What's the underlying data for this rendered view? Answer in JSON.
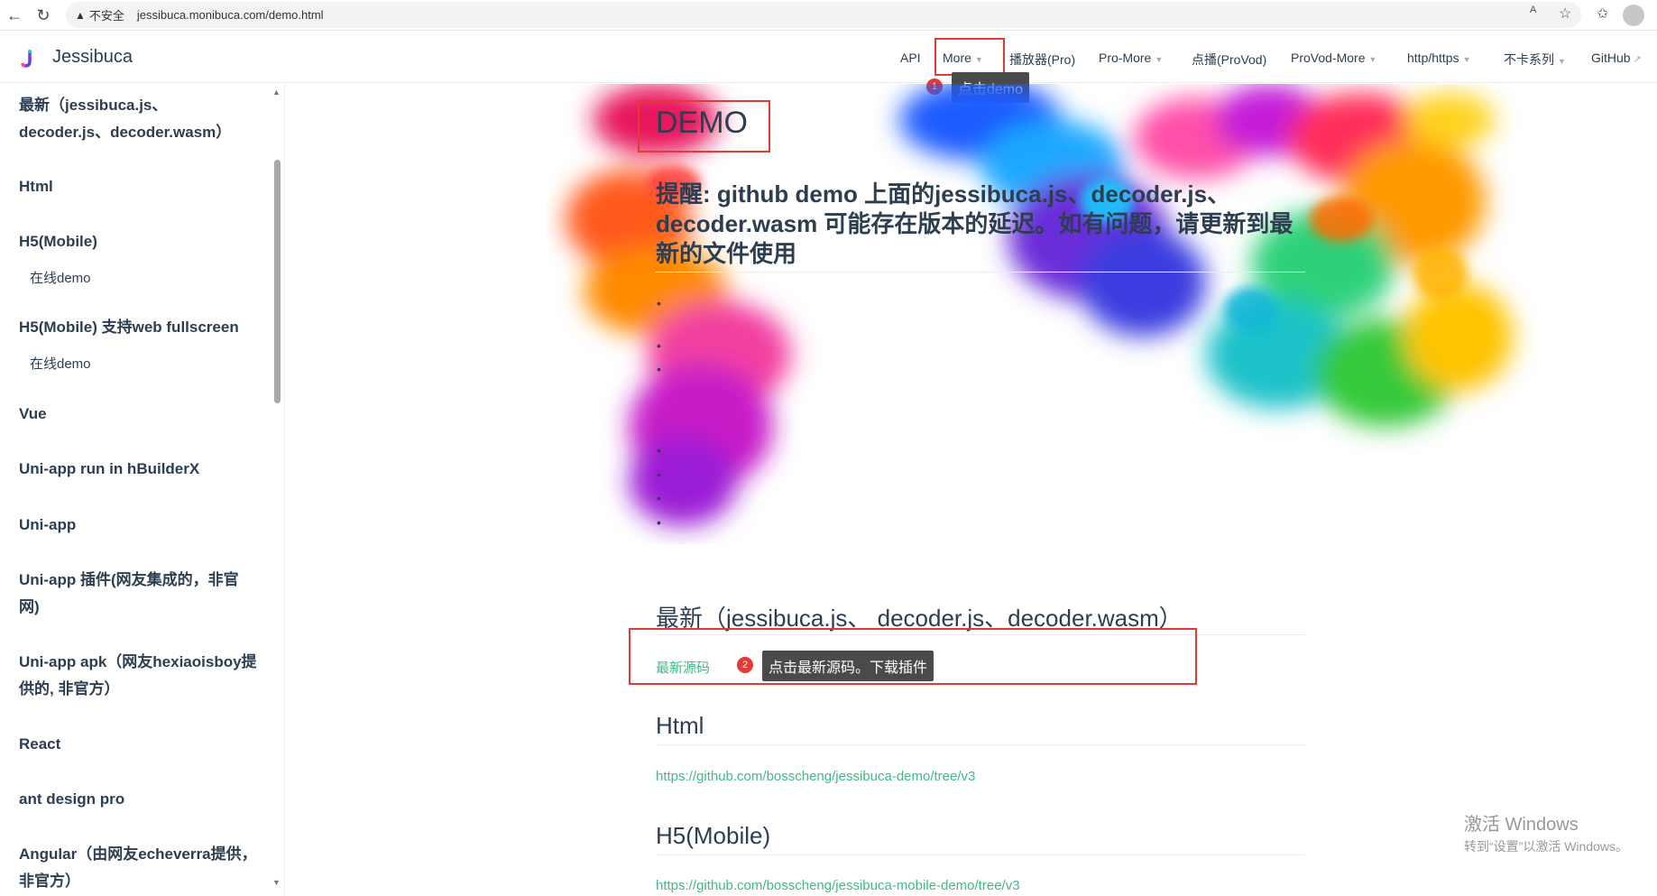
{
  "browser": {
    "security_label": "不安全",
    "url": "jessibuca.monibuca.com/demo.html"
  },
  "site": {
    "title": "Jessibuca",
    "nav": [
      {
        "label": "API"
      },
      {
        "label": "More"
      },
      {
        "label": "播放器(Pro)"
      },
      {
        "label": "Pro-More"
      },
      {
        "label": "点播(ProVod)"
      },
      {
        "label": "ProVod-More"
      },
      {
        "label": "http/https"
      },
      {
        "label": "不卡系列"
      },
      {
        "label": "GitHub"
      }
    ]
  },
  "sidebar": {
    "items": [
      {
        "label": "最新（jessibuca.js、decoder.js、decoder.wasm）"
      },
      {
        "label": "Html"
      },
      {
        "label": "H5(Mobile)"
      },
      {
        "label": "在线demo"
      },
      {
        "label": "H5(Mobile) 支持web fullscreen"
      },
      {
        "label": "在线demo"
      },
      {
        "label": "Vue"
      },
      {
        "label": "Uni-app run in hBuilderX"
      },
      {
        "label": "Uni-app"
      },
      {
        "label": "Uni-app 插件(网友集成的，非官网)"
      },
      {
        "label": "Uni-app apk（网友hexiaoisboy提供的, 非官方）"
      },
      {
        "label": "React"
      },
      {
        "label": "ant design pro"
      },
      {
        "label": "Angular（由网友echeverra提供，非官方）"
      }
    ]
  },
  "content": {
    "title": "DEMO",
    "notice": "提醒: github demo 上面的jessibuca.js、decoder.js、decoder.wasm 可能存在版本的延迟。如有问题，请更新到最新的文件使用",
    "sections": [
      {
        "heading": "最新（jessibuca.js、 decoder.js、decoder.wasm）",
        "link": "最新源码"
      },
      {
        "heading": "Html",
        "link": "https://github.com/bosscheng/jessibuca-demo/tree/v3"
      },
      {
        "heading": "H5(Mobile)",
        "link": "https://github.com/bosscheng/jessibuca-mobile-demo/tree/v3"
      }
    ]
  },
  "annotations": {
    "badge1": "1",
    "tip1": "点击demo",
    "badge2": "2",
    "tip2": "点击最新源码。下载插件",
    "box_color": "#e53935"
  },
  "watermark": {
    "line1": "激活 Windows",
    "line2": "转到“设置”以激活 Windows。"
  }
}
